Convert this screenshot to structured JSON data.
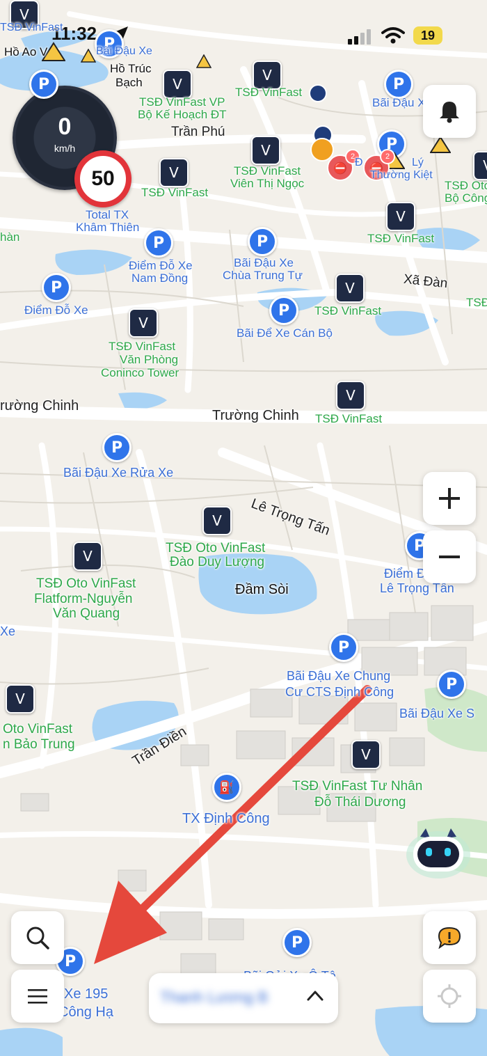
{
  "status_bar": {
    "time": "11:32",
    "battery": "19"
  },
  "speedometer": {
    "speed": "0",
    "unit": "km/h",
    "speed_limit": "50"
  },
  "labels": {
    "ho_ao_v": "Hồ Ao V",
    "bai_dau_xe_top": "Bãi Đậu Xe",
    "ho_truc_bach_1": "Hồ Trúc",
    "ho_truc_bach_2": "Bạch",
    "tsd_vinfast_top_left": "TSĐ VinFast",
    "tsd_vinfast_top": "TSĐ VinFast",
    "bai_dau_xe_right": "Bãi Đậu Xe",
    "tsd_vp_1": "TSĐ VinFast VP",
    "tsd_vp_2": "Bộ Kế Hoạch ĐT",
    "tran_phu": "Trần Phú",
    "ly_1": "Đ",
    "ly_2": "Lý",
    "ly_3": "Thường Kiệt",
    "tsd_vtn_1": "TSĐ VinFast",
    "tsd_vtn_2": "Viên Thị Ngọc",
    "tsd_vinfast_mid": "TSĐ VinFast",
    "tsd_oto_right_1": "TSĐ Oto",
    "tsd_oto_right_2": "Bộ Công",
    "total_tx_1": "Total TX",
    "total_tx_2": "Khâm Thiên",
    "tsd_vinfast_right": "TSĐ VinFast",
    "han": "hàn",
    "diem_do_xe_nd_1": "Điểm Đỗ Xe",
    "diem_do_xe_nd_2": "Nam Đồng",
    "bai_dau_ctt_1": "Bãi Đậu Xe",
    "bai_dau_ctt_2": "Chùa Trung Tự",
    "xa_dan": "Xã Đàn",
    "tsd_edge": "TSĐ",
    "diem_do_xe": "Điểm Đỗ Xe",
    "tsd_vinfast_xd": "TSĐ VinFast",
    "bai_de_xe_cb": "Bãi Để Xe Cán Bộ",
    "tsd_conico_1": "TSĐ VinFast",
    "tsd_conico_2": "Văn Phòng",
    "tsd_conico_3": "Coninco Tower",
    "truong_chinh_left": "rường Chinh",
    "truong_chinh": "Trường Chinh",
    "tsd_vinfast_tc": "TSĐ VinFast",
    "bai_dau_rua_xe": "Bãi Đậu Xe Rửa Xe",
    "le_trong_tan": "Lê Trọng Tấn",
    "tsd_ddl_1": "TSĐ Oto VinFast",
    "tsd_ddl_2": "Đào Duy Lượng",
    "diem_ltt_1": "Điểm Đ",
    "diem_ltt_2": "Lê Trọng Tấn",
    "tsd_nvq_1": "TSĐ Oto VinFast",
    "tsd_nvq_2": "Flatform-Nguyễn",
    "tsd_nvq_3": "Văn Quang",
    "dam_soi": "Đầm Sòi",
    "xe_edge": "Xe",
    "bai_cts_1": "Bãi Đậu Xe Chung",
    "bai_cts_2": "Cư CTS Định Công",
    "bai_dau_xe_s": "Bãi Đậu Xe S",
    "oto_vinfast_edge_1": "Oto VinFast",
    "oto_vinfast_edge_2": "n Bảo Trung",
    "tran_dien": "Trần Điền",
    "tsd_ttn_1": "TSĐ VinFast Tư Nhân",
    "tsd_ttn_2": "Đỗ Thái Dương",
    "tx_dinh_cong": "TX Định Công",
    "bai_gui_xe": "Bãi Gửi Xe Ô Tô",
    "xe195_1": "Xe 195",
    "xe195_2": "Công Hạ"
  },
  "bottom_bar": {
    "text": "Thanh Lương B"
  },
  "icons": {
    "parking": "P",
    "vinfast": "V",
    "fuel": "⛽"
  },
  "colors": {
    "accent": "#2f74ea",
    "poi_green": "#2ea84a",
    "poi_blue": "#3b6fd6",
    "arrow": "#e5483c"
  }
}
